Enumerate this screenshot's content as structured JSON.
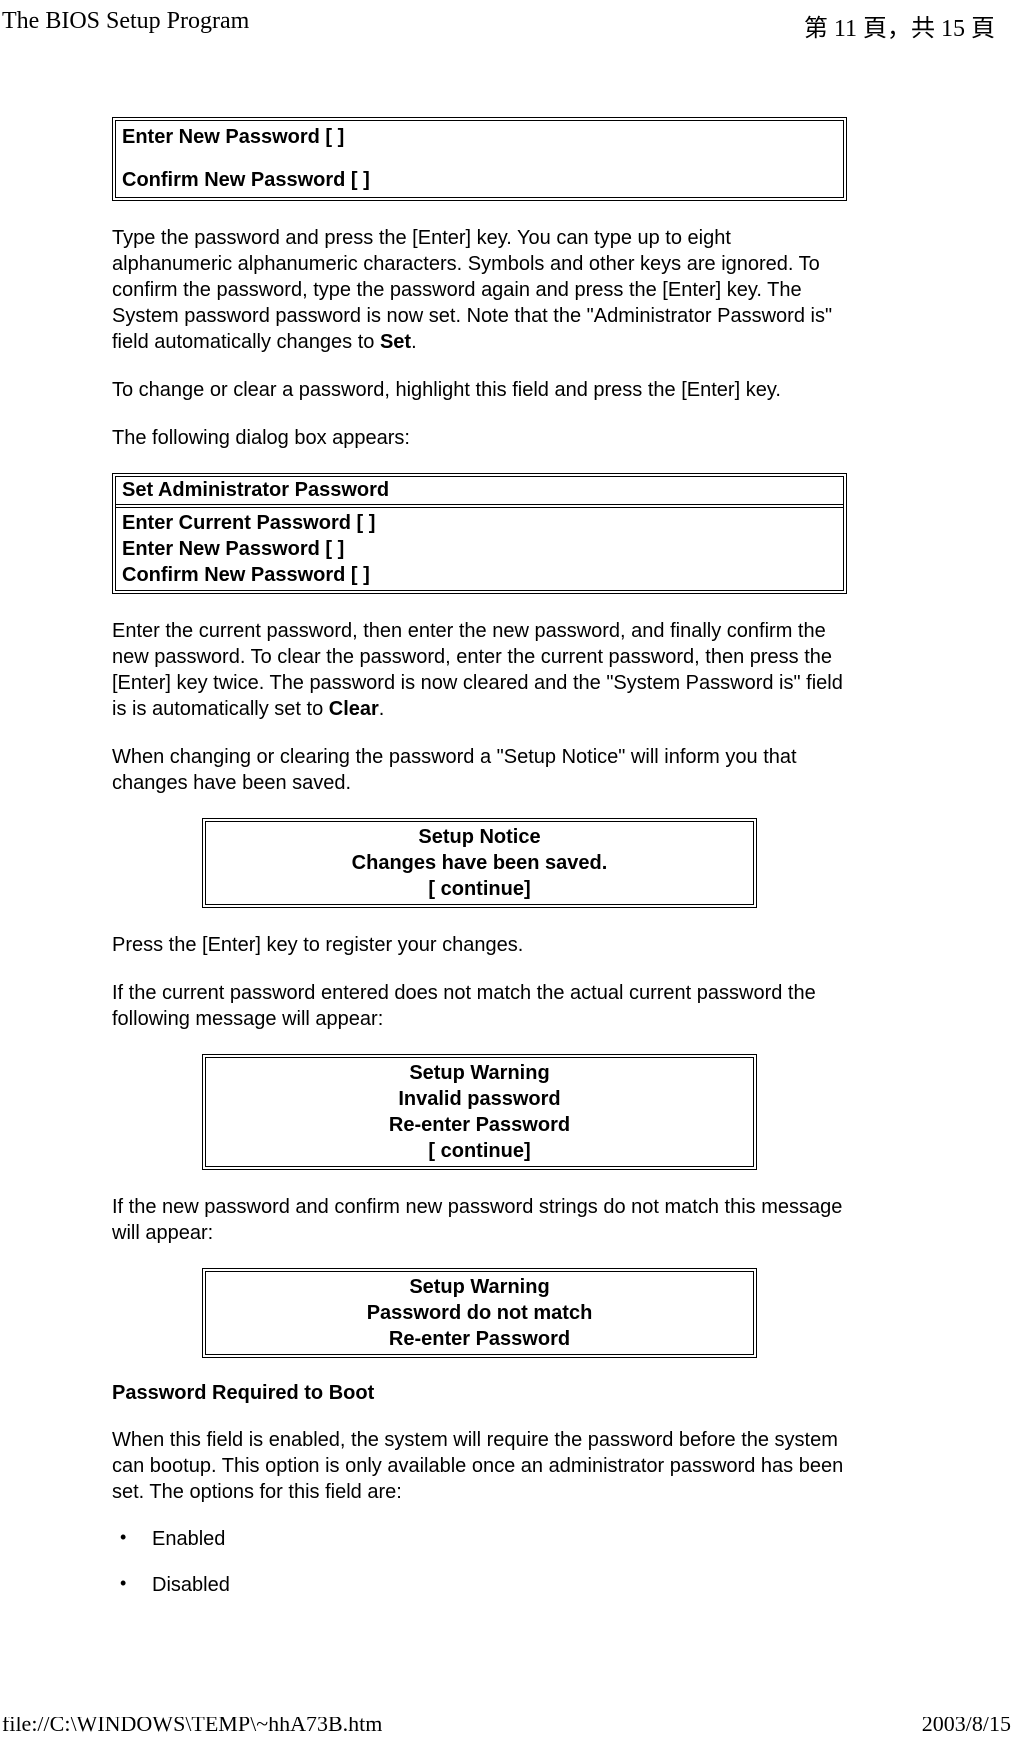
{
  "header": {
    "title_left": "The BIOS Setup Program",
    "page_indicator": "第 11 頁，共 15 頁"
  },
  "box1": {
    "line1": "Enter New Password [ ]",
    "line2": "Confirm New Password [ ]"
  },
  "para1_a": "Type the password and press the [Enter] key. You can type up to eight alphanumeric alphanumeric characters. Symbols and other keys are ignored. To confirm the password, type the password again and press the [Enter] key. The System password password is now set. Note that the \"Administrator Password is\" field automatically changes to ",
  "para1_b": "Set",
  "para1_c": ".",
  "para2": "To change or clear a password, highlight this field and press the [Enter] key.",
  "para3": "The following dialog box appears:",
  "box2": {
    "title": "Set Administrator Password",
    "line1": "Enter Current Password [ ]",
    "line2": "Enter New Password [ ]",
    "line3": "Confirm New Password [ ]"
  },
  "para4_a": "Enter the current password, then enter the new password, and finally confirm the new password. To clear the password, enter the current password, then press the [Enter] key twice. The password is now cleared and the \"System Password is\" field is is automatically set to ",
  "para4_b": "Clear",
  "para4_c": ".",
  "para5": "When changing or clearing the password a \"Setup Notice\" will inform you that changes have been saved.",
  "notice1": {
    "l1": "Setup Notice",
    "l2": "Changes have been saved.",
    "l3": "[ continue]"
  },
  "para6": "Press the [Enter] key to register your changes.",
  "para7": "If the current password entered does not match the actual current password the following message will appear:",
  "notice2": {
    "l1": "Setup Warning",
    "l2": "Invalid password",
    "l3": "Re-enter Password",
    "l4": "[ continue]"
  },
  "para8": "If the new password and confirm new password strings do not match this message will appear:",
  "notice3": {
    "l1": "Setup Warning",
    "l2": "Password do not match",
    "l3": "Re-enter Password"
  },
  "section": {
    "heading": "Password Required to Boot",
    "body": "When this field is enabled, the system will require the password before the system can bootup. This option is only available once an administrator password has been set. The options for this field are:",
    "opt1": "Enabled",
    "opt2": "Disabled"
  },
  "footer": {
    "path": "file://C:\\WINDOWS\\TEMP\\~hhA73B.htm",
    "date": "2003/8/15"
  }
}
